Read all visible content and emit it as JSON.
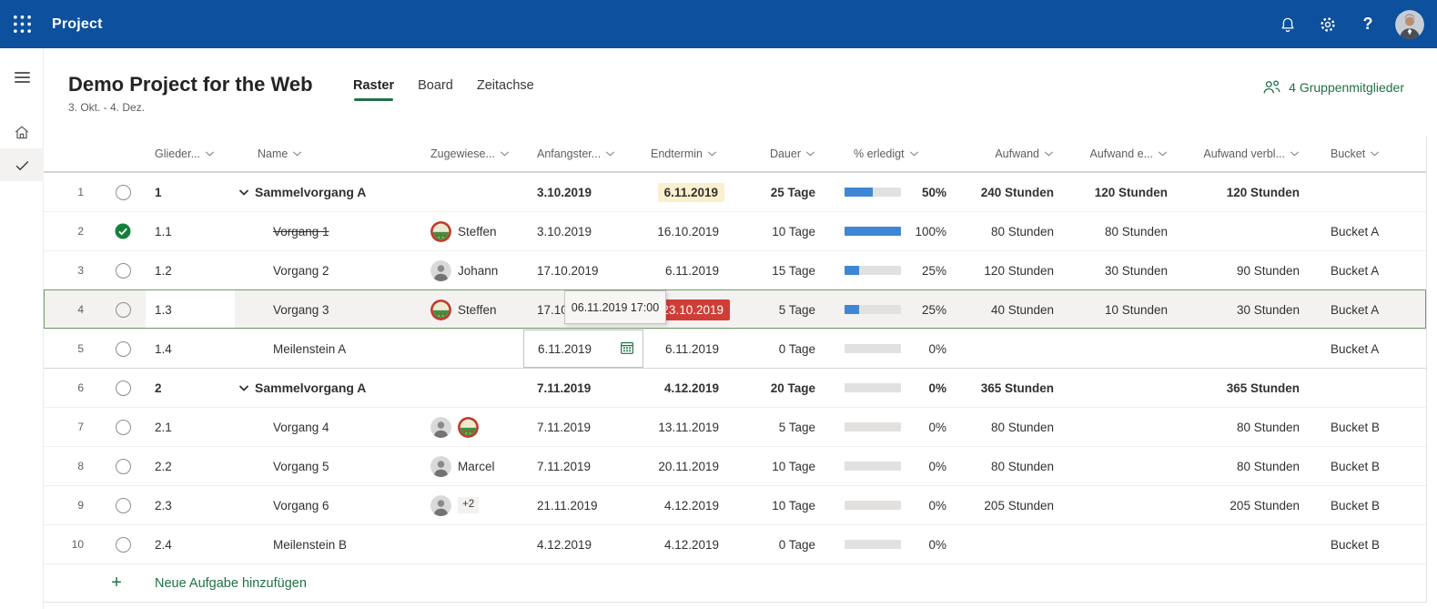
{
  "topbar": {
    "app_title": "Project",
    "help_label": "?",
    "icons": [
      "waffle-icon",
      "bell-icon",
      "gear-icon",
      "help-icon",
      "user-avatar"
    ]
  },
  "sidebar": {
    "items": [
      {
        "icon": "hamburger-icon",
        "active": false
      },
      {
        "icon": "home-icon",
        "active": false
      },
      {
        "icon": "check-icon",
        "active": true
      }
    ]
  },
  "header": {
    "title": "Demo Project for the Web",
    "date_range": "3. Okt. - 4. Dez.",
    "tabs": [
      {
        "label": "Raster",
        "active": true
      },
      {
        "label": "Board",
        "active": false
      },
      {
        "label": "Zeitachse",
        "active": false
      }
    ],
    "members_label": "4 Gruppenmitglieder",
    "members_icon": "people-icon"
  },
  "table": {
    "columns": [
      {
        "label": "Glieder..."
      },
      {
        "label": "Name"
      },
      {
        "label": "Zugewiese..."
      },
      {
        "label": "Anfangster..."
      },
      {
        "label": "Endtermin"
      },
      {
        "label": "Dauer"
      },
      {
        "label": "% erledigt"
      },
      {
        "label": "Aufwand"
      },
      {
        "label": "Aufwand e..."
      },
      {
        "label": "Aufwand verbl..."
      },
      {
        "label": "Bucket"
      }
    ],
    "rows": [
      {
        "num": "1",
        "status": "open",
        "outline": "1",
        "name": "Sammelvorgang A",
        "assignee": "",
        "start": "3.10.2019",
        "end": "6.11.2019",
        "end_highlight": "warning",
        "dauer": "25 Tage",
        "pct": 50,
        "pct_label": "50%",
        "aufwand": "240 Stunden",
        "aufwand_erledigt": "120 Stunden",
        "aufwand_verbleibend": "120 Stunden",
        "bucket": ""
      },
      {
        "num": "2",
        "status": "done",
        "outline": "1.1",
        "name": "Vorgang 1",
        "assignee": "Steffen",
        "start": "3.10.2019",
        "end": "16.10.2019",
        "dauer": "10 Tage",
        "pct": 100,
        "pct_label": "100%",
        "aufwand": "80 Stunden",
        "aufwand_erledigt": "80 Stunden",
        "aufwand_verbleibend": "",
        "bucket": "Bucket A"
      },
      {
        "num": "3",
        "status": "open",
        "outline": "1.2",
        "name": "Vorgang 2",
        "assignee": "Johann",
        "start": "17.10.2019",
        "end": "6.11.2019",
        "dauer": "15 Tage",
        "pct": 25,
        "pct_label": "25%",
        "aufwand": "120 Stunden",
        "aufwand_erledigt": "30 Stunden",
        "aufwand_verbleibend": "90 Stunden",
        "bucket": "Bucket A"
      },
      {
        "num": "4",
        "status": "open",
        "outline": "1.3",
        "name": "Vorgang 3",
        "assignee": "Steffen",
        "start": "17.10.2019",
        "end": "23.10.2019",
        "end_highlight": "error",
        "dauer": "5 Tage",
        "pct": 25,
        "pct_label": "25%",
        "aufwand": "40 Stunden",
        "aufwand_erledigt": "10 Stunden",
        "aufwand_verbleibend": "30 Stunden",
        "bucket": "Bucket A"
      },
      {
        "num": "5",
        "status": "open",
        "outline": "1.4",
        "name": "Meilenstein A",
        "assignee": "",
        "start": "6.11.2019",
        "end": "6.11.2019",
        "dauer": "0 Tage",
        "pct": 0,
        "pct_label": "0%",
        "aufwand": "",
        "aufwand_erledigt": "",
        "aufwand_verbleibend": "",
        "bucket": "Bucket A"
      },
      {
        "num": "6",
        "status": "open",
        "outline": "2",
        "name": "Sammelvorgang A",
        "assignee": "",
        "start": "7.11.2019",
        "end": "4.12.2019",
        "dauer": "20 Tage",
        "pct": 0,
        "pct_label": "0%",
        "aufwand": "365 Stunden",
        "aufwand_erledigt": "",
        "aufwand_verbleibend": "365 Stunden",
        "bucket": ""
      },
      {
        "num": "7",
        "status": "open",
        "outline": "2.1",
        "name": "Vorgang 4",
        "assignee": "",
        "start": "7.11.2019",
        "end": "13.11.2019",
        "dauer": "5 Tage",
        "pct": 0,
        "pct_label": "0%",
        "aufwand": "80 Stunden",
        "aufwand_erledigt": "",
        "aufwand_verbleibend": "80 Stunden",
        "bucket": "Bucket B"
      },
      {
        "num": "8",
        "status": "open",
        "outline": "2.2",
        "name": "Vorgang 5",
        "assignee": "Marcel",
        "start": "7.11.2019",
        "end": "20.11.2019",
        "dauer": "10 Tage",
        "pct": 0,
        "pct_label": "0%",
        "aufwand": "80 Stunden",
        "aufwand_erledigt": "",
        "aufwand_verbleibend": "80 Stunden",
        "bucket": "Bucket B"
      },
      {
        "num": "9",
        "status": "open",
        "outline": "2.3",
        "name": "Vorgang 6",
        "assignee": "",
        "extra": "+2",
        "start": "21.11.2019",
        "end": "4.12.2019",
        "dauer": "10 Tage",
        "pct": 0,
        "pct_label": "0%",
        "aufwand": "205 Stunden",
        "aufwand_erledigt": "",
        "aufwand_verbleibend": "205 Stunden",
        "bucket": "Bucket B"
      },
      {
        "num": "10",
        "status": "open",
        "outline": "2.4",
        "name": "Meilenstein B",
        "assignee": "",
        "start": "4.12.2019",
        "end": "4.12.2019",
        "dauer": "0 Tage",
        "pct": 0,
        "pct_label": "0%",
        "aufwand": "",
        "aufwand_erledigt": "",
        "aufwand_verbleibend": "",
        "bucket": "Bucket B"
      }
    ],
    "add_task": {
      "plus": "+",
      "label": "Neue Aufgabe hinzufügen"
    }
  },
  "overlays": {
    "datetime_tooltip": "06.11.2019 17:00",
    "edit_date_value": "6.11.2019",
    "edit_date_icon": "calendar-icon"
  },
  "colors": {
    "topbar_blue": "#0d509e",
    "accent_green": "#1e7145",
    "selection_green": "#6f9f68",
    "progress_blue": "#3f87d4",
    "done_green": "#15803c",
    "overdue_red": "#cf3e36",
    "warning_yellow": "#fbf0ce"
  }
}
